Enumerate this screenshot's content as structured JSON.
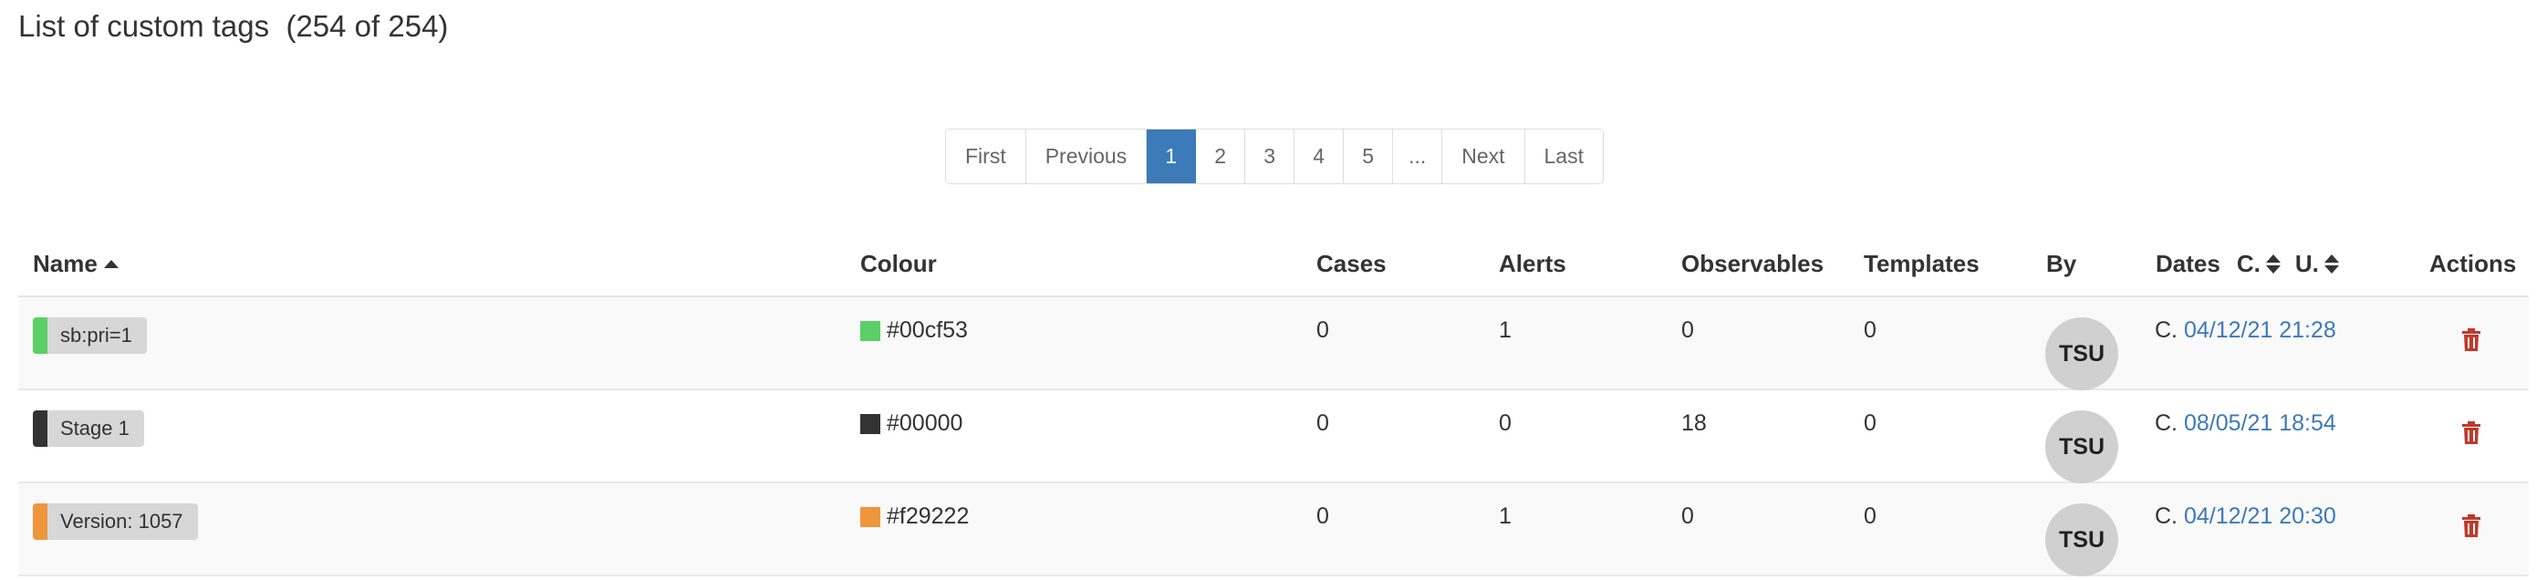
{
  "page": {
    "title": "List of custom tags  (254 of 254)"
  },
  "pagination": {
    "first": "First",
    "previous": "Previous",
    "pages": [
      "1",
      "2",
      "3",
      "4",
      "5"
    ],
    "ellipsis": "...",
    "next": "Next",
    "last": "Last",
    "active_page": "1"
  },
  "table": {
    "headers": {
      "name": "Name",
      "colour": "Colour",
      "cases": "Cases",
      "alerts": "Alerts",
      "observables": "Observables",
      "templates": "Templates",
      "by": "By",
      "dates": "Dates",
      "dates_created": "C.",
      "dates_updated": "U.",
      "actions": "Actions"
    },
    "rows": [
      {
        "name": "sb:pri=1",
        "colour": "#00cf53",
        "swatch_color": "#5ccf66",
        "cases": "0",
        "alerts": "1",
        "observables": "0",
        "templates": "0",
        "by": "TSU",
        "date_prefix": "C.",
        "date": "04/12/21 21:28"
      },
      {
        "name": "Stage 1",
        "colour": "#00000",
        "swatch_color": "#333333",
        "cases": "0",
        "alerts": "0",
        "observables": "18",
        "templates": "0",
        "by": "TSU",
        "date_prefix": "C.",
        "date": "08/05/21 18:54"
      },
      {
        "name": "Version: 1057",
        "colour": "#f29222",
        "swatch_color": "#ef963d",
        "cases": "0",
        "alerts": "1",
        "observables": "0",
        "templates": "0",
        "by": "TSU",
        "date_prefix": "C.",
        "date": "04/12/21 20:30"
      }
    ]
  },
  "icons": {
    "sort_ascending": "sort-asc-icon",
    "sort_both": "sort-both-icon",
    "delete": "trash-icon"
  },
  "colors": {
    "accent": "#3c7ab8",
    "delete": "#c0392b",
    "tag_background": "#d7d7d7"
  }
}
